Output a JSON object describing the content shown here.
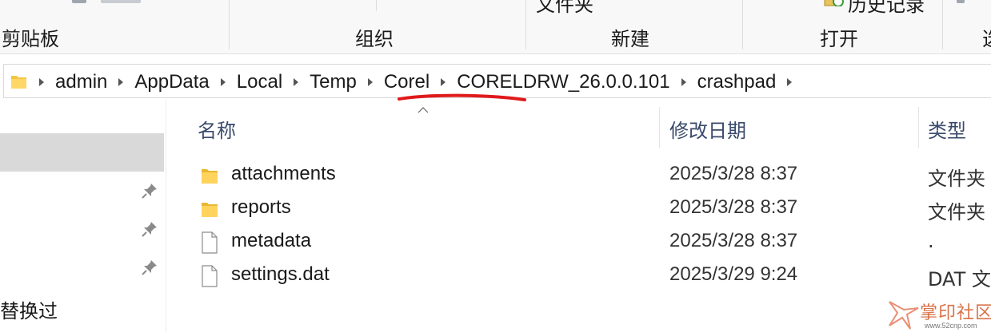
{
  "ribbon": {
    "groups": [
      {
        "label": "剪贴板"
      },
      {
        "label": "组织"
      },
      {
        "label": "新建"
      },
      {
        "label": "打开"
      }
    ],
    "partial_top_new_folder": "文件夹",
    "partial_top_history": "历史记录",
    "partial_edge": "选"
  },
  "address_bar": {
    "breadcrumbs": [
      "admin",
      "AppData",
      "Local",
      "Temp",
      "Corel",
      "CORELDRW_26.0.0.101",
      "crashpad"
    ],
    "annotation_color": "#e0191b"
  },
  "navigation": {
    "bottom_item": "替换过"
  },
  "file_list": {
    "columns": {
      "name": "名称",
      "date": "修改日期",
      "type": "类型"
    },
    "rows": [
      {
        "name": "attachments",
        "date": "2025/3/28 8:37",
        "type": "文件夹",
        "icon": "folder-icon"
      },
      {
        "name": "reports",
        "date": "2025/3/28 8:37",
        "type": "文件夹",
        "icon": "folder-icon"
      },
      {
        "name": "metadata",
        "date": "2025/3/28 8:37",
        "type": ".",
        "icon": "file-icon"
      },
      {
        "name": "settings.dat",
        "date": "2025/3/29 9:24",
        "type": "DAT 文",
        "icon": "file-icon"
      }
    ]
  },
  "watermark": {
    "text": "掌印社区",
    "url": "www.52cnp.com"
  }
}
